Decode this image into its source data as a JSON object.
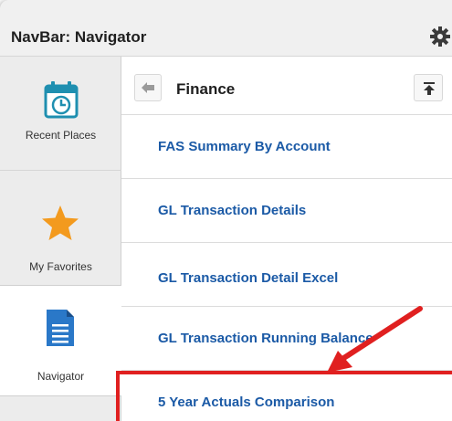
{
  "header": {
    "title": "NavBar: Navigator",
    "settings_icon": "gear-icon"
  },
  "sidebar": {
    "items": [
      {
        "label": "Recent Places",
        "icon": "calendar-clock-icon",
        "active": false
      },
      {
        "label": "My Favorites",
        "icon": "star-icon",
        "active": false
      },
      {
        "label": "Navigator",
        "icon": "document-icon",
        "active": true
      }
    ]
  },
  "main": {
    "breadcrumb_title": "Finance",
    "back_icon": "back-arrow-icon",
    "top_icon": "scroll-to-top-icon",
    "items": [
      {
        "label": "FAS Summary By Account"
      },
      {
        "label": "GL Transaction Details"
      },
      {
        "label": "GL Transaction Detail Excel"
      },
      {
        "label": "GL Transaction Running Balance"
      },
      {
        "label": "5 Year Actuals Comparison",
        "highlighted": true
      }
    ]
  },
  "colors": {
    "link": "#1b5aa6",
    "highlight": "#e02020",
    "star": "#f39a1e",
    "doc": "#2a78c8"
  }
}
